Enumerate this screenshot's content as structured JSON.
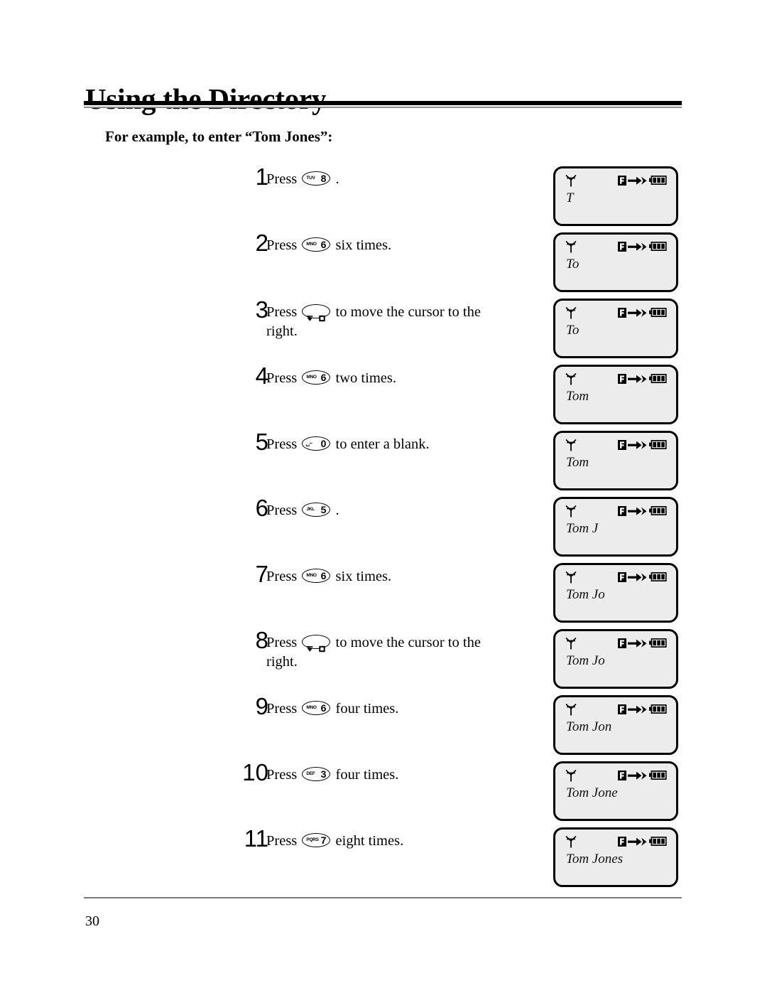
{
  "document": {
    "title": "Using the Directory",
    "subheading": "For example, to enter “Tom Jones”:",
    "page_number": "30"
  },
  "steps": [
    {
      "number": "1",
      "prefix": "Press",
      "key": {
        "type": "digit",
        "letters": "TUV",
        "digit": "8",
        "name": "key-8-tuv"
      },
      "suffix": "."
    },
    {
      "number": "2",
      "prefix": "Press",
      "key": {
        "type": "digit",
        "letters": "MNO",
        "digit": "6",
        "name": "key-6-mno"
      },
      "suffix": "six times."
    },
    {
      "number": "3",
      "prefix": "Press",
      "key": {
        "type": "cursor",
        "letters": "",
        "digit": "",
        "name": "key-cursor-right"
      },
      "suffix": "to move the cursor to the right."
    },
    {
      "number": "4",
      "prefix": "Press",
      "key": {
        "type": "digit",
        "letters": "MNO",
        "digit": "6",
        "name": "key-6-mno"
      },
      "suffix": "two times."
    },
    {
      "number": "5",
      "prefix": "Press",
      "key": {
        "type": "zero",
        "letters": "␣–",
        "digit": "0",
        "name": "key-0-space"
      },
      "suffix": "to enter a blank."
    },
    {
      "number": "6",
      "prefix": "Press",
      "key": {
        "type": "digit",
        "letters": "JKL",
        "digit": "5",
        "name": "key-5-jkl"
      },
      "suffix": "."
    },
    {
      "number": "7",
      "prefix": "Press",
      "key": {
        "type": "digit",
        "letters": "MNO",
        "digit": "6",
        "name": "key-6-mno"
      },
      "suffix": "six times."
    },
    {
      "number": "8",
      "prefix": "Press",
      "key": {
        "type": "cursor",
        "letters": "",
        "digit": "",
        "name": "key-cursor-right"
      },
      "suffix": "to move the cursor to the right."
    },
    {
      "number": "9",
      "prefix": "Press",
      "key": {
        "type": "digit",
        "letters": "MNO",
        "digit": "6",
        "name": "key-6-mno"
      },
      "suffix": "four times."
    },
    {
      "number": "10",
      "prefix": "Press",
      "key": {
        "type": "digit",
        "letters": "DEF",
        "digit": "3",
        "name": "key-3-def"
      },
      "suffix": "four times."
    },
    {
      "number": "11",
      "prefix": "Press",
      "key": {
        "type": "digit",
        "letters": "PQRS",
        "digit": "7",
        "name": "key-7-pqrs"
      },
      "suffix": "eight times."
    }
  ],
  "displays": [
    {
      "text": "T",
      "icons": [
        "antenna-icon",
        "function-arrow-icon",
        "battery-icon"
      ],
      "battery_bars": 3
    },
    {
      "text": "To",
      "icons": [
        "antenna-icon",
        "function-arrow-icon",
        "battery-icon"
      ],
      "battery_bars": 3
    },
    {
      "text": "To",
      "icons": [
        "antenna-icon",
        "function-arrow-icon",
        "battery-icon"
      ],
      "battery_bars": 3
    },
    {
      "text": "Tom",
      "icons": [
        "antenna-icon",
        "function-arrow-icon",
        "battery-icon"
      ],
      "battery_bars": 3
    },
    {
      "text": "Tom",
      "icons": [
        "antenna-icon",
        "function-arrow-icon",
        "battery-icon"
      ],
      "battery_bars": 3
    },
    {
      "text": "Tom J",
      "icons": [
        "antenna-icon",
        "function-arrow-icon",
        "battery-icon"
      ],
      "battery_bars": 3
    },
    {
      "text": "Tom Jo",
      "icons": [
        "antenna-icon",
        "function-arrow-icon",
        "battery-icon"
      ],
      "battery_bars": 3
    },
    {
      "text": "Tom Jo",
      "icons": [
        "antenna-icon",
        "function-arrow-icon",
        "battery-icon"
      ],
      "battery_bars": 3
    },
    {
      "text": "Tom Jon",
      "icons": [
        "antenna-icon",
        "function-arrow-icon",
        "battery-icon"
      ],
      "battery_bars": 3
    },
    {
      "text": "Tom Jone",
      "icons": [
        "antenna-icon",
        "function-arrow-icon",
        "battery-icon"
      ],
      "battery_bars": 3
    },
    {
      "text": "Tom Jones",
      "icons": [
        "antenna-icon",
        "function-arrow-icon",
        "battery-icon"
      ],
      "battery_bars": 3
    }
  ],
  "layout": {
    "step_tops": [
      232,
      325,
      419,
      512,
      605,
      698,
      791,
      884,
      977,
      1070,
      1163
    ],
    "num_lefts": [
      318,
      318,
      318,
      318,
      318,
      318,
      318,
      318,
      318,
      318,
      318
    ],
    "display_tops": [
      234,
      327,
      420,
      513,
      606,
      699,
      792,
      885,
      978,
      1071,
      1164
    ]
  },
  "colors": {
    "lcd_background": "#ececec",
    "lcd_border": "#000000",
    "rule_thick": "#000000",
    "rule_thin": "#8a8a8a",
    "text": "#000000"
  }
}
